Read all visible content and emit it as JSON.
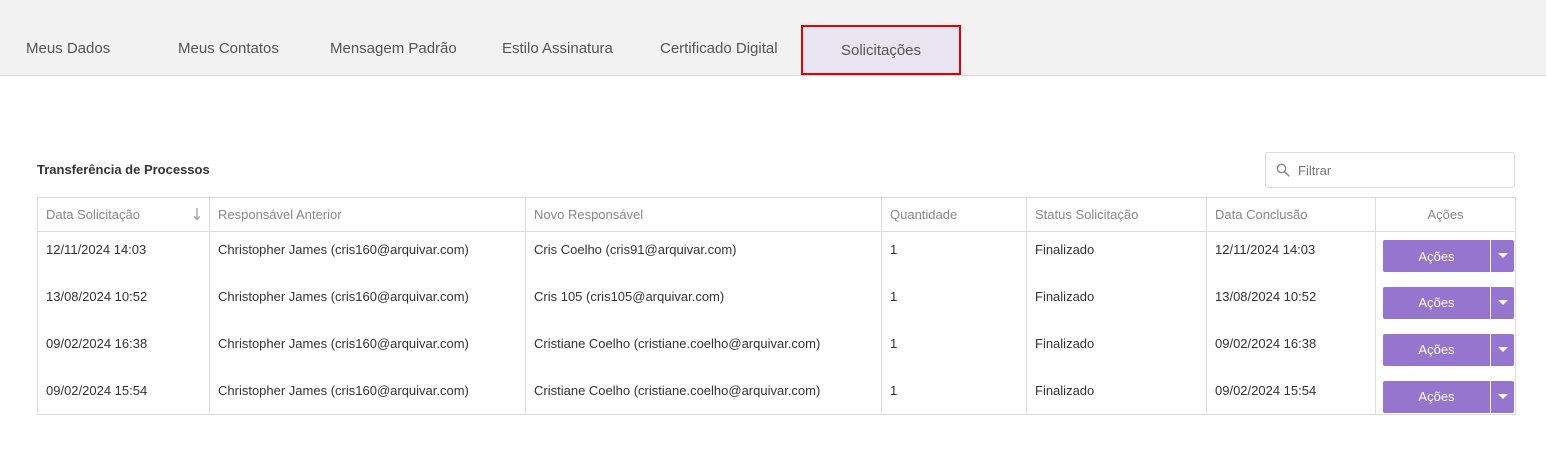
{
  "tabs": [
    {
      "label": "Meus Dados"
    },
    {
      "label": "Meus Contatos"
    },
    {
      "label": "Mensagem Padrão"
    },
    {
      "label": "Estilo Assinatura"
    },
    {
      "label": "Certificado Digital"
    },
    {
      "label": "Solicitações",
      "active": true
    }
  ],
  "section": {
    "title": "Transferência de Processos"
  },
  "filter": {
    "placeholder": "Filtrar",
    "icon": "search-icon"
  },
  "table": {
    "columns": [
      "Data Solicitação",
      "Responsável Anterior",
      "Novo Responsável",
      "Quantidade",
      "Status Solicitação",
      "Data Conclusão",
      "Ações"
    ],
    "sort_icon": "arrow-down-icon",
    "rows": [
      {
        "data_solicitacao": "12/11/2024 14:03",
        "responsavel_anterior": "Christopher James (cris160@arquivar.com)",
        "novo_responsavel": "Cris Coelho (cris91@arquivar.com)",
        "quantidade": "1",
        "status": "Finalizado",
        "data_conclusao": "12/11/2024 14:03",
        "acoes_label": "Ações"
      },
      {
        "data_solicitacao": "13/08/2024 10:52",
        "responsavel_anterior": "Christopher James (cris160@arquivar.com)",
        "novo_responsavel": "Cris 105 (cris105@arquivar.com)",
        "quantidade": "1",
        "status": "Finalizado",
        "data_conclusao": "13/08/2024 10:52",
        "acoes_label": "Ações"
      },
      {
        "data_solicitacao": "09/02/2024 16:38",
        "responsavel_anterior": "Christopher James (cris160@arquivar.com)",
        "novo_responsavel": "Cristiane Coelho (cristiane.coelho@arquivar.com)",
        "quantidade": "1",
        "status": "Finalizado",
        "data_conclusao": "09/02/2024 16:38",
        "acoes_label": "Ações"
      },
      {
        "data_solicitacao": "09/02/2024 15:54",
        "responsavel_anterior": "Christopher James (cris160@arquivar.com)",
        "novo_responsavel": "Cristiane Coelho (cristiane.coelho@arquivar.com)",
        "quantidade": "1",
        "status": "Finalizado",
        "data_conclusao": "09/02/2024 15:54",
        "acoes_label": "Ações"
      }
    ]
  },
  "colors": {
    "accent": "#9575cd",
    "active_tab_bg": "#e9e5f0",
    "highlight_border": "#e30000"
  }
}
